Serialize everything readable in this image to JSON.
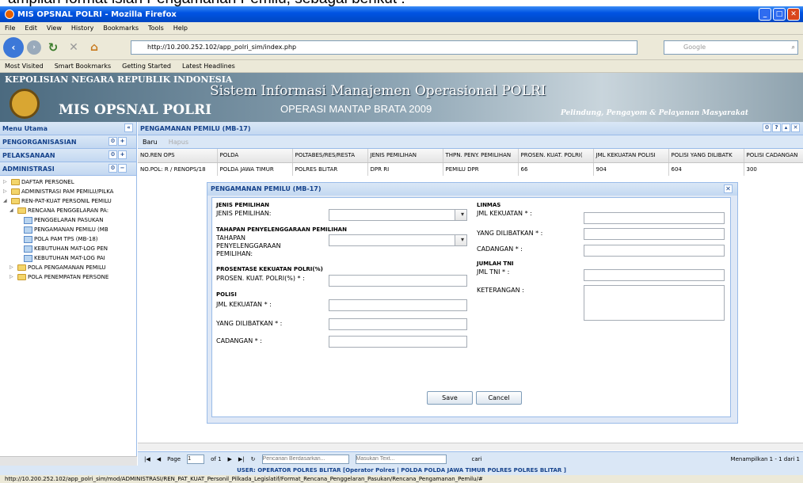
{
  "caption": {
    "text": "ampilan format isian Pengamanan Pemilu, sebagai berikut :"
  },
  "window": {
    "title": "MIS OPSNAL POLRI - Mozilla Firefox"
  },
  "menu": [
    "File",
    "Edit",
    "View",
    "History",
    "Bookmarks",
    "Tools",
    "Help"
  ],
  "nav": {
    "url": "http://10.200.252.102/app_polri_sim/index.php",
    "search_placeholder": "Google"
  },
  "bookmarks": [
    "Most Visited",
    "Smart Bookmarks",
    "Getting Started",
    "Latest Headlines"
  ],
  "banner": {
    "org": "KEPOLISIAN NEGARA REPUBLIK INDONESIA",
    "app": "MIS OPSNAL POLRI",
    "system": "Sistem Informasi Manajemen Operasional POLRI",
    "operation": "OPERASI MANTAP BRATA 2009",
    "motto": "Pelindung, Pengayom & Pelayanan Masyarakat"
  },
  "sidebar": {
    "title": "Menu Utama",
    "sections": [
      "PENGORGANISASIAN",
      "PELAKSANAAN",
      "ADMINISTRASI"
    ],
    "tree": [
      {
        "label": "DAFTAR PERSONEL",
        "indent": 0,
        "kind": "folder"
      },
      {
        "label": "ADMINISTRASI PAM PEMILU/PILKA",
        "indent": 0,
        "kind": "folder"
      },
      {
        "label": "REN-PAT-KUAT PERSONIL PEMILU",
        "indent": 0,
        "kind": "folder"
      },
      {
        "label": "RENCANA PENGGELARAN PA:",
        "indent": 1,
        "kind": "folder"
      },
      {
        "label": "PENGGELARAN PASUKAN",
        "indent": 2,
        "kind": "page"
      },
      {
        "label": "PENGAMANAN PEMILU (MB",
        "indent": 2,
        "kind": "page"
      },
      {
        "label": "POLA PAM TPS (MB-18)",
        "indent": 2,
        "kind": "page"
      },
      {
        "label": "KEBUTUHAN MAT-LOG PEN",
        "indent": 2,
        "kind": "page"
      },
      {
        "label": "KEBUTUHAN MAT-LOG PAI",
        "indent": 2,
        "kind": "page"
      },
      {
        "label": "POLA PENGAMANAN PEMILU",
        "indent": 1,
        "kind": "folder"
      },
      {
        "label": "POLA PENEMPATAN PERSONE",
        "indent": 1,
        "kind": "folder"
      }
    ]
  },
  "main": {
    "title": "PENGAMANAN PEMILU (MB-17)",
    "toolbar": {
      "new": "Baru",
      "delete": "Hapus"
    },
    "columns": [
      "NO.REN OPS",
      "POLDA",
      "POLTABES/RES/RESTA",
      "JENIS PEMILIHAN",
      "THPN. PENY. PEMILIHAN",
      "PROSEN. KUAT. POLRI(",
      "JML KEKUATAN POLISI",
      "POLISI YANG DILIBATK",
      "POLISI CADANGAN"
    ],
    "rows": [
      [
        "NO.POL: R / RENOPS/18",
        "POLDA JAWA TIMUR",
        "POLRES BLITAR",
        "DPR RI",
        "PEMILU DPR",
        "66",
        "904",
        "604",
        "300"
      ]
    ],
    "pager": {
      "page_label": "Page",
      "page": "1",
      "of": "of 1",
      "search_placeholder": "Pencarian Berdasarkan...",
      "text_placeholder": "Masukan Text...",
      "search_btn": "cari",
      "summary": "Menampilkan 1 - 1 dari 1"
    }
  },
  "modal": {
    "title": "PENGAMANAN PEMILU (MB-17)",
    "left": {
      "jenis_header": "JENIS PEMILIHAN",
      "jenis_label": "JENIS PEMILIHAN:",
      "tahapan_header": "TAHAPAN PENYELENGGARAAN PEMILIHAN",
      "tahapan_label_1": "TAHAPAN",
      "tahapan_label_2": "PENYELENGGARAAN",
      "tahapan_label_3": "PEMILIHAN:",
      "prosentase_header": "PROSENTASE KEKUATAN POLRI(%)",
      "prosentase_label": "PROSEN. KUAT. POLRI(%) * :",
      "polisi_header": "POLISI",
      "jml_label": "JML KEKUATAN * :",
      "dilibatkan_label": "YANG DILIBATKAN * :",
      "cadangan_label": "CADANGAN * :"
    },
    "right": {
      "linmas_header": "LINMAS",
      "jml_label": "JML KEKUATAN * :",
      "dilibatkan_label": "YANG DILIBATKAN * :",
      "cadangan_label": "CADANGAN * :",
      "tni_header": "JUMLAH TNI",
      "tni_label": "JML TNI * :",
      "keterangan_label": "KETERANGAN :"
    },
    "buttons": {
      "save": "Save",
      "cancel": "Cancel"
    }
  },
  "userbar": "USER: OPERATOR POLRES BLITAR [Operator Polres | POLDA POLDA JAWA TIMUR POLRES POLRES BLITAR ]",
  "status": "http://10.200.252.102/app_polri_sim/mod/ADMINISTRASI/REN_PAT_KUAT_Personil_Pilkada_Legislatif/Format_Rencana_Penggelaran_Pasukan/Rencana_Pengamanan_Pemilu/#"
}
